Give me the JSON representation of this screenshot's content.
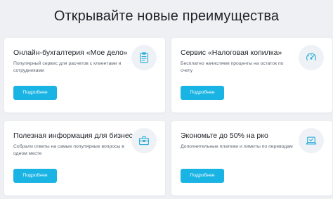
{
  "header": {
    "title": "Открывайте новые преимущества"
  },
  "cards": [
    {
      "title": "Онлайн-бухгалтерия «Мое дело»",
      "description": "Популярный сервис для расчетов с клиентами и сотрудниками",
      "button_label": "Подробнее",
      "icon": "clipboard-icon"
    },
    {
      "title": "Сервис «Налоговая копилка»",
      "description": "Бесплатно начисляем проценты на остаток по счету",
      "button_label": "Подробнее",
      "icon": "speedometer-icon"
    },
    {
      "title": "Полезная информация для бизнеса",
      "description": "Собрали ответы на самые популярные вопросы в одном месте",
      "button_label": "Подробнее",
      "icon": "briefcase-icon"
    },
    {
      "title": "Экономьте до 50% на рко",
      "description": "Дополнительные платежи и лимиты по переводам",
      "button_label": "Подробнее",
      "icon": "laptop-icon"
    }
  ],
  "colors": {
    "accent": "#1ab4e4",
    "background": "#eef0f4",
    "card": "#ffffff",
    "icon_stroke": "#1aa9d6"
  }
}
